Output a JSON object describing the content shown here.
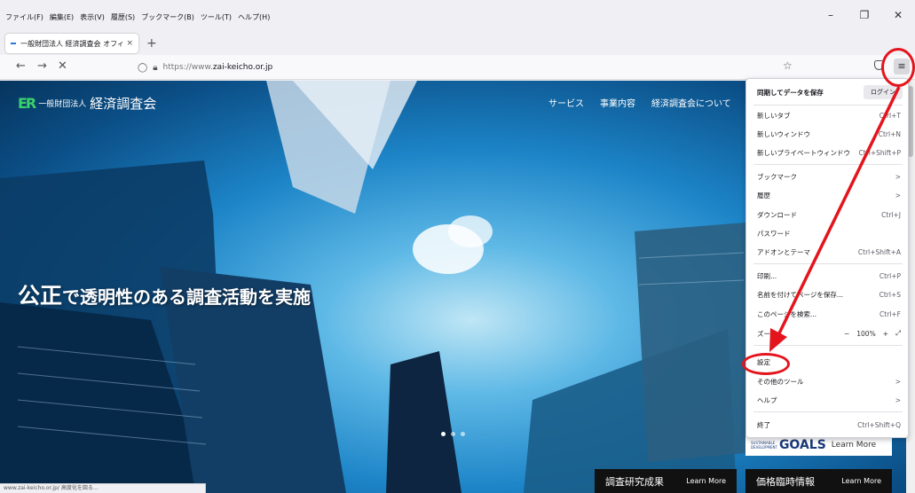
{
  "browser": {
    "menubar": [
      "ファイル(F)",
      "編集(E)",
      "表示(V)",
      "履歴(S)",
      "ブックマーク(B)",
      "ツール(T)",
      "ヘルプ(H)"
    ],
    "window_controls": {
      "minimize": "–",
      "restore": "❐",
      "close": "✕"
    },
    "tab": {
      "label": "一般財団法人 経済調査会 オフィ",
      "close": "×"
    },
    "new_tab": "+",
    "nav": {
      "back": "←",
      "forward": "→",
      "stop": "✕"
    },
    "url": {
      "prefix": "https://www.",
      "domain": "zai-keicho.or.jp"
    },
    "statusbar": "www.zai-keicho.or.jp/ 高度化を図る…"
  },
  "site": {
    "logo_mark": "ER",
    "logo_small": "一般財団法人",
    "logo_big": "経済調査会",
    "nav": [
      "サービス",
      "事業内容",
      "経済調査会について"
    ],
    "headline_em": "公正",
    "headline_rest": "で透明性のある調査活動を実施",
    "sdg": {
      "small1": "SUSTAINABLE",
      "small2": "DEVELOPMENT",
      "goals": "GOALS",
      "learn": "Learn More"
    },
    "boxes": [
      {
        "title": "調査研究成果",
        "learn": "Learn More"
      },
      {
        "title": "価格臨時情報",
        "learn": "Learn More"
      }
    ]
  },
  "menu": {
    "sync": "同期してデータを保存",
    "login": "ログイン",
    "items": {
      "new_tab": {
        "label": "新しいタブ",
        "shortcut": "Ctrl+T"
      },
      "new_window": {
        "label": "新しいウィンドウ",
        "shortcut": "Ctrl+N"
      },
      "private": {
        "label": "新しいプライベートウィンドウ",
        "shortcut": "Ctrl+Shift+P"
      },
      "bookmarks": {
        "label": "ブックマーク",
        "shortcut": ">"
      },
      "history": {
        "label": "履歴",
        "shortcut": ">"
      },
      "downloads": {
        "label": "ダウンロード",
        "shortcut": "Ctrl+J"
      },
      "passwords": {
        "label": "パスワード",
        "shortcut": ""
      },
      "addons": {
        "label": "アドオンとテーマ",
        "shortcut": "Ctrl+Shift+A"
      },
      "print": {
        "label": "印刷...",
        "shortcut": "Ctrl+P"
      },
      "save_page": {
        "label": "名前を付けてページを保存...",
        "shortcut": "Ctrl+S"
      },
      "find": {
        "label": "このページを検索...",
        "shortcut": "Ctrl+F"
      },
      "zoom": {
        "label": "ズーム",
        "minus": "−",
        "value": "100%",
        "plus": "+",
        "fullscreen": "⤢"
      },
      "settings": {
        "label": "設定",
        "shortcut": ""
      },
      "more_tools": {
        "label": "その他のツール",
        "shortcut": ">"
      },
      "help": {
        "label": "ヘルプ",
        "shortcut": ">"
      },
      "quit": {
        "label": "終了",
        "shortcut": "Ctrl+Shift+Q"
      }
    }
  },
  "colors": {
    "annotation": "#e4141d",
    "logo_green": "#3bd16b"
  }
}
